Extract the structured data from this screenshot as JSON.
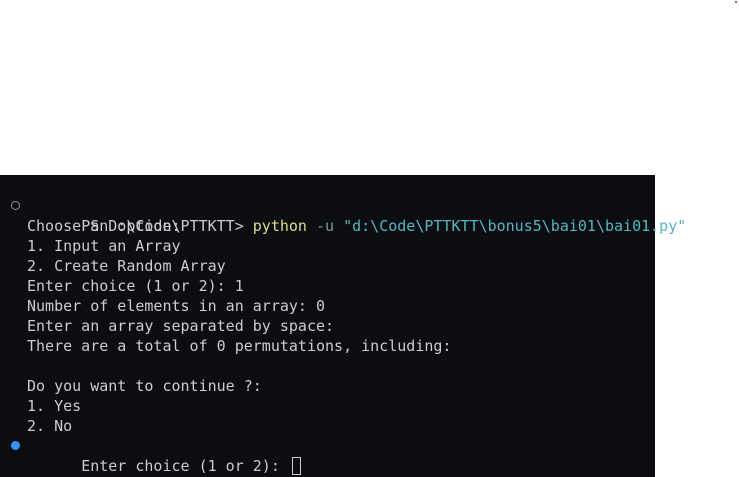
{
  "terminal": {
    "command": {
      "prompt": "PS D:\\Code\\PTTKTT>",
      "program": "python",
      "flag": "-u",
      "path": "\"d:\\Code\\PTTKTT\\bonus5\\bai01\\bai01.py\""
    },
    "output": [
      "Choose an option:",
      "1. Input an Array",
      "2. Create Random Array",
      "Enter choice (1 or 2): 1",
      "Number of elements in an array: 0",
      "Enter an array separated by space:",
      "There are a total of 0 permutations, including:",
      "",
      "Do you want to continue ?:",
      "1. Yes",
      "2. No"
    ],
    "input_prompt": "Enter choice (1 or 2): "
  }
}
